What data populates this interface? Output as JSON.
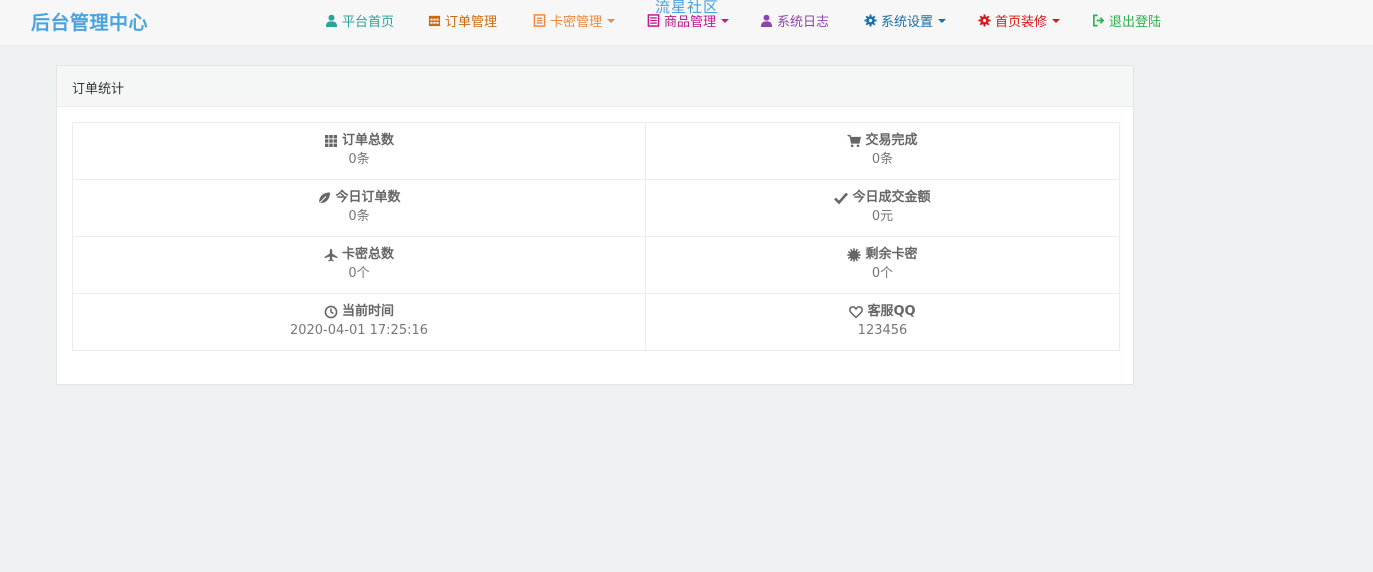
{
  "brand": "后台管理中心",
  "watermark": "流星社区",
  "colors": {
    "brand": "#4aa3df",
    "nav_home": "#29a39b",
    "nav_orders": "#cc6a12",
    "nav_cards": "#f0883c",
    "nav_goods": "#c2188e",
    "nav_logs": "#8e44ad",
    "nav_settings": "#1a6fa8",
    "nav_decor": "#d81818",
    "nav_logout": "#2bb24c"
  },
  "nav": [
    {
      "label": "平台首页",
      "icon": "user-icon",
      "dropdown": false
    },
    {
      "label": "订单管理",
      "icon": "calendar-icon",
      "dropdown": false
    },
    {
      "label": "卡密管理",
      "icon": "list-icon",
      "dropdown": true
    },
    {
      "label": "商品管理",
      "icon": "book-icon",
      "dropdown": true
    },
    {
      "label": "系统日志",
      "icon": "user-icon",
      "dropdown": false
    },
    {
      "label": "系统设置",
      "icon": "gear-icon",
      "dropdown": true
    },
    {
      "label": "首页装修",
      "icon": "gear-icon",
      "dropdown": true
    },
    {
      "label": "退出登陆",
      "icon": "logout-icon",
      "dropdown": false
    }
  ],
  "panel": {
    "title": "订单统计"
  },
  "stats": [
    {
      "label": "订单总数",
      "value": "0条",
      "icon": "grid-icon"
    },
    {
      "label": "交易完成",
      "value": "0条",
      "icon": "cart-icon"
    },
    {
      "label": "今日订单数",
      "value": "0条",
      "icon": "leaf-icon"
    },
    {
      "label": "今日成交金额",
      "value": "0元",
      "icon": "check-icon"
    },
    {
      "label": "卡密总数",
      "value": "0个",
      "icon": "plane-icon"
    },
    {
      "label": "剩余卡密",
      "value": "0个",
      "icon": "certificate-icon"
    },
    {
      "label": "当前时间",
      "value": "2020-04-01 17:25:16",
      "icon": "clock-icon"
    },
    {
      "label": "客服QQ",
      "value": "123456",
      "icon": "heart-icon"
    }
  ]
}
